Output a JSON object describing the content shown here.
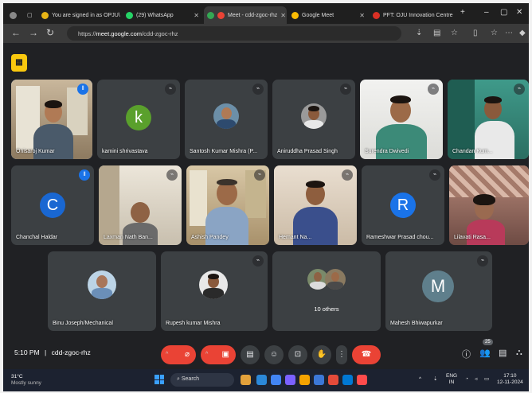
{
  "browser": {
    "tabs": [
      {
        "label": "You are signed in as OPJU\\",
        "favicon_color": "#e7b416"
      },
      {
        "label": "(29) WhatsApp",
        "favicon_color": "#25d366"
      },
      {
        "label": "Meet - cdd-zgoc-rhz",
        "favicon_color": "#34a853"
      },
      {
        "label": "Google Meet",
        "favicon_color": "#fbbc04"
      },
      {
        "label": "PFT: OJU Innovation Centre",
        "favicon_color": "#d93025"
      }
    ],
    "url_prefix": "https://",
    "url_host": "meet.google.com",
    "url_path": "/cdd-zgoc-rhz"
  },
  "participants_row1": [
    {
      "name": "Onisaroj Kumar",
      "type": "camera",
      "speaking": true
    },
    {
      "name": "kamini shrivastava",
      "type": "letter",
      "letter": "k",
      "avatar_color": "#5aa02c"
    },
    {
      "name": "Santosh Kumar Mishra (P...",
      "type": "photo"
    },
    {
      "name": "Aniruddha Prasad Singh",
      "type": "photo"
    },
    {
      "name": "Surendra Dwivedi",
      "type": "camera"
    },
    {
      "name": "Chandan Kum...",
      "type": "camera"
    }
  ],
  "participants_row2": [
    {
      "name": "Chanchal Haldar",
      "type": "letter",
      "letter": "C",
      "avatar_color": "#1967d2"
    },
    {
      "name": "Laxman Nath Ban...",
      "type": "camera"
    },
    {
      "name": "Ashish Pandey",
      "type": "camera"
    },
    {
      "name": "Hemant Na...",
      "type": "camera"
    },
    {
      "name": "Rameshwar Prasad chou...",
      "type": "letter",
      "letter": "R",
      "avatar_color": "#1a73e8"
    },
    {
      "name": "Lilavati Rasa...",
      "type": "camera"
    }
  ],
  "participants_row3": [
    {
      "name": "Binu Joseph/Mechanical",
      "type": "photo"
    },
    {
      "name": "Rupesh kumar Mishra",
      "type": "photo"
    },
    {
      "name": "10 others",
      "type": "group"
    },
    {
      "name": "Mahesh Bhiwapurkar",
      "type": "letter",
      "letter": "M",
      "avatar_color": "#5f7f8c"
    }
  ],
  "meeting": {
    "time": "5:10 PM",
    "separator": "|",
    "code": "cdd-zgoc-rhz",
    "people_count": "25"
  },
  "taskbar": {
    "temperature": "31°C",
    "weather": "Mostly sunny",
    "search_label": "Search",
    "lang": "ENG",
    "region": "IN",
    "clock_time": "17:10",
    "clock_date": "12-11-2024"
  }
}
